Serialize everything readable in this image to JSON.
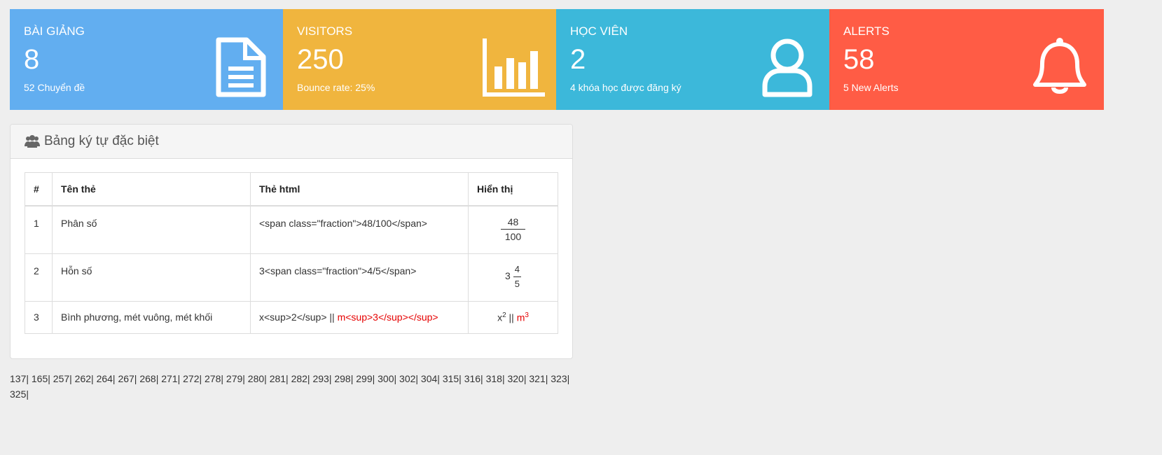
{
  "cards": [
    {
      "title": "BÀI GIẢNG",
      "number": "8",
      "sub": "52 Chuyển đề",
      "color": "#62aef0",
      "icon": "document-icon"
    },
    {
      "title": "VISITORS",
      "number": "250",
      "sub": "Bounce rate: 25%",
      "color": "#f0b53e",
      "icon": "bar-chart-icon"
    },
    {
      "title": "HỌC VIÊN",
      "number": "2",
      "sub": "4 khóa học được đăng ký",
      "color": "#3cb8da",
      "icon": "user-icon"
    },
    {
      "title": "ALERTS",
      "number": "58",
      "sub": "5 New Alerts",
      "color": "#ff5c45",
      "icon": "bell-icon"
    }
  ],
  "panel": {
    "title": "Bảng ký tự đặc biệt",
    "icon": "users-icon"
  },
  "table": {
    "headers": [
      "#",
      "Tên thẻ",
      "Thẻ html",
      "Hiển thị"
    ],
    "rows": [
      {
        "idx": "1",
        "name": "Phân số",
        "html": "<span class=\"fraction\">48/100</span>",
        "show_num": "48",
        "show_den": "100"
      },
      {
        "idx": "2",
        "name": "Hỗn số",
        "html": "3<span class=\"fraction\">4/5</span>",
        "show_whole": "3",
        "show_num": "4",
        "show_den": "5"
      },
      {
        "idx": "3",
        "name": "Bình phương, mét vuông, mét khối",
        "html_a": "x<sup>2</sup> ||",
        "html_b": "m<sup>3</sup></sup>",
        "show_a_base": "x",
        "show_a_exp": "2",
        "show_sep": "||",
        "show_b_base": "m",
        "show_b_exp": "3"
      }
    ]
  },
  "pages": [
    "137|",
    "165|",
    "257|",
    "262|",
    "264|",
    "267|",
    "268|",
    "271|",
    "272|",
    "278|",
    "279|",
    "280|",
    "281|",
    "282|",
    "293|",
    "298|",
    "299|",
    "300|",
    "302|",
    "304|",
    "315|",
    "316|",
    "318|",
    "320|",
    "321|",
    "323|",
    "325|"
  ]
}
